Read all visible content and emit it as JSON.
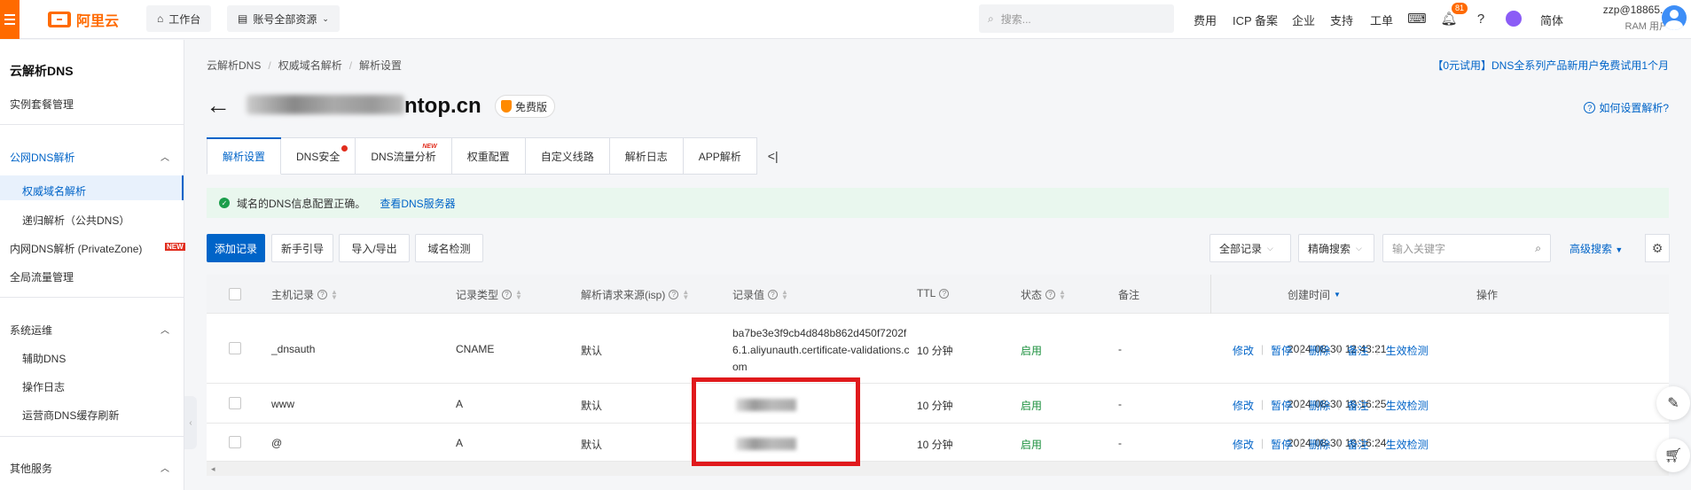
{
  "topbar": {
    "brand": "阿里云",
    "workbench": "工作台",
    "account_scope": "账号全部资源",
    "search_placeholder": "搜索...",
    "links": [
      "费用",
      "ICP 备案",
      "企业",
      "支持",
      "工单"
    ],
    "notification_count": "81",
    "lang": "简体",
    "user_name": "zzp@18865...",
    "user_role": "RAM 用户"
  },
  "sidebar": {
    "title": "云解析DNS",
    "items": [
      {
        "label": "实例套餐管理"
      },
      {
        "label": "公网DNS解析"
      },
      {
        "label": "权威域名解析"
      },
      {
        "label": "递归解析（公共DNS）"
      },
      {
        "label": "内网DNS解析 (PrivateZone)",
        "tag": "NEW"
      },
      {
        "label": "全局流量管理"
      },
      {
        "label": "系统运维"
      },
      {
        "label": "辅助DNS"
      },
      {
        "label": "操作日志"
      },
      {
        "label": "运营商DNS缓存刷新"
      },
      {
        "label": "其他服务"
      }
    ]
  },
  "main": {
    "breadcrumb": [
      "云解析DNS",
      "权威域名解析",
      "解析设置"
    ],
    "promo": "【0元试用】DNS全系列产品新用户免费试用1个月",
    "domain_suffix": "ntop.cn",
    "plan_tag": "免费版",
    "help_link": "如何设置解析?",
    "tabs": [
      {
        "label": "解析设置"
      },
      {
        "label": "DNS安全"
      },
      {
        "label": "DNS流量分析",
        "sup": "NEW"
      },
      {
        "label": "权重配置"
      },
      {
        "label": "自定义线路"
      },
      {
        "label": "解析日志"
      },
      {
        "label": "APP解析"
      }
    ],
    "tab_collapse": "<|",
    "alert_text": "域名的DNS信息配置正确。",
    "alert_link": "查看DNS服务器",
    "toolbar": {
      "add_record": "添加记录",
      "guide": "新手引导",
      "import_export": "导入/导出",
      "domain_check": "域名检测",
      "record_filter": "全部记录",
      "search_mode": "精确搜索",
      "keyword_placeholder": "输入关键字",
      "advanced_search": "高级搜索"
    },
    "table": {
      "headers": {
        "host": "主机记录",
        "type": "记录类型",
        "isp": "解析请求来源(isp)",
        "value": "记录值",
        "ttl": "TTL",
        "status": "状态",
        "remark": "备注",
        "created": "创建时间",
        "ops": "操作"
      },
      "rows": [
        {
          "host": "_dnsauth",
          "type": "CNAME",
          "isp": "默认",
          "value": "ba7be3e3f9cb4d848b862d450f7202f6.1.aliyunauth.certificate-validations.com",
          "value_lines": [
            "ba7be3e3f9cb4d848b862d450f7202f",
            "6.1.aliyunauth.certificate-validations.c",
            "om"
          ],
          "ttl": "10 分钟",
          "status": "启用",
          "remark": "-",
          "created": "2024-08-30 12:43:21"
        },
        {
          "host": "www",
          "type": "A",
          "isp": "默认",
          "value": "",
          "ttl": "10 分钟",
          "status": "启用",
          "remark": "-",
          "created": "2024-08-30 10:16:25"
        },
        {
          "host": "@",
          "type": "A",
          "isp": "默认",
          "value": "",
          "ttl": "10 分钟",
          "status": "启用",
          "remark": "-",
          "created": "2024-08-30 10:16:24"
        }
      ],
      "ops": [
        "修改",
        "暂停",
        "删除",
        "备注",
        "生效检测"
      ]
    }
  },
  "colors": {
    "brand_orange": "#ff6a00",
    "primary_blue": "#0064c8",
    "status_green": "#1a8f3c",
    "highlight_red": "#e0191c"
  }
}
